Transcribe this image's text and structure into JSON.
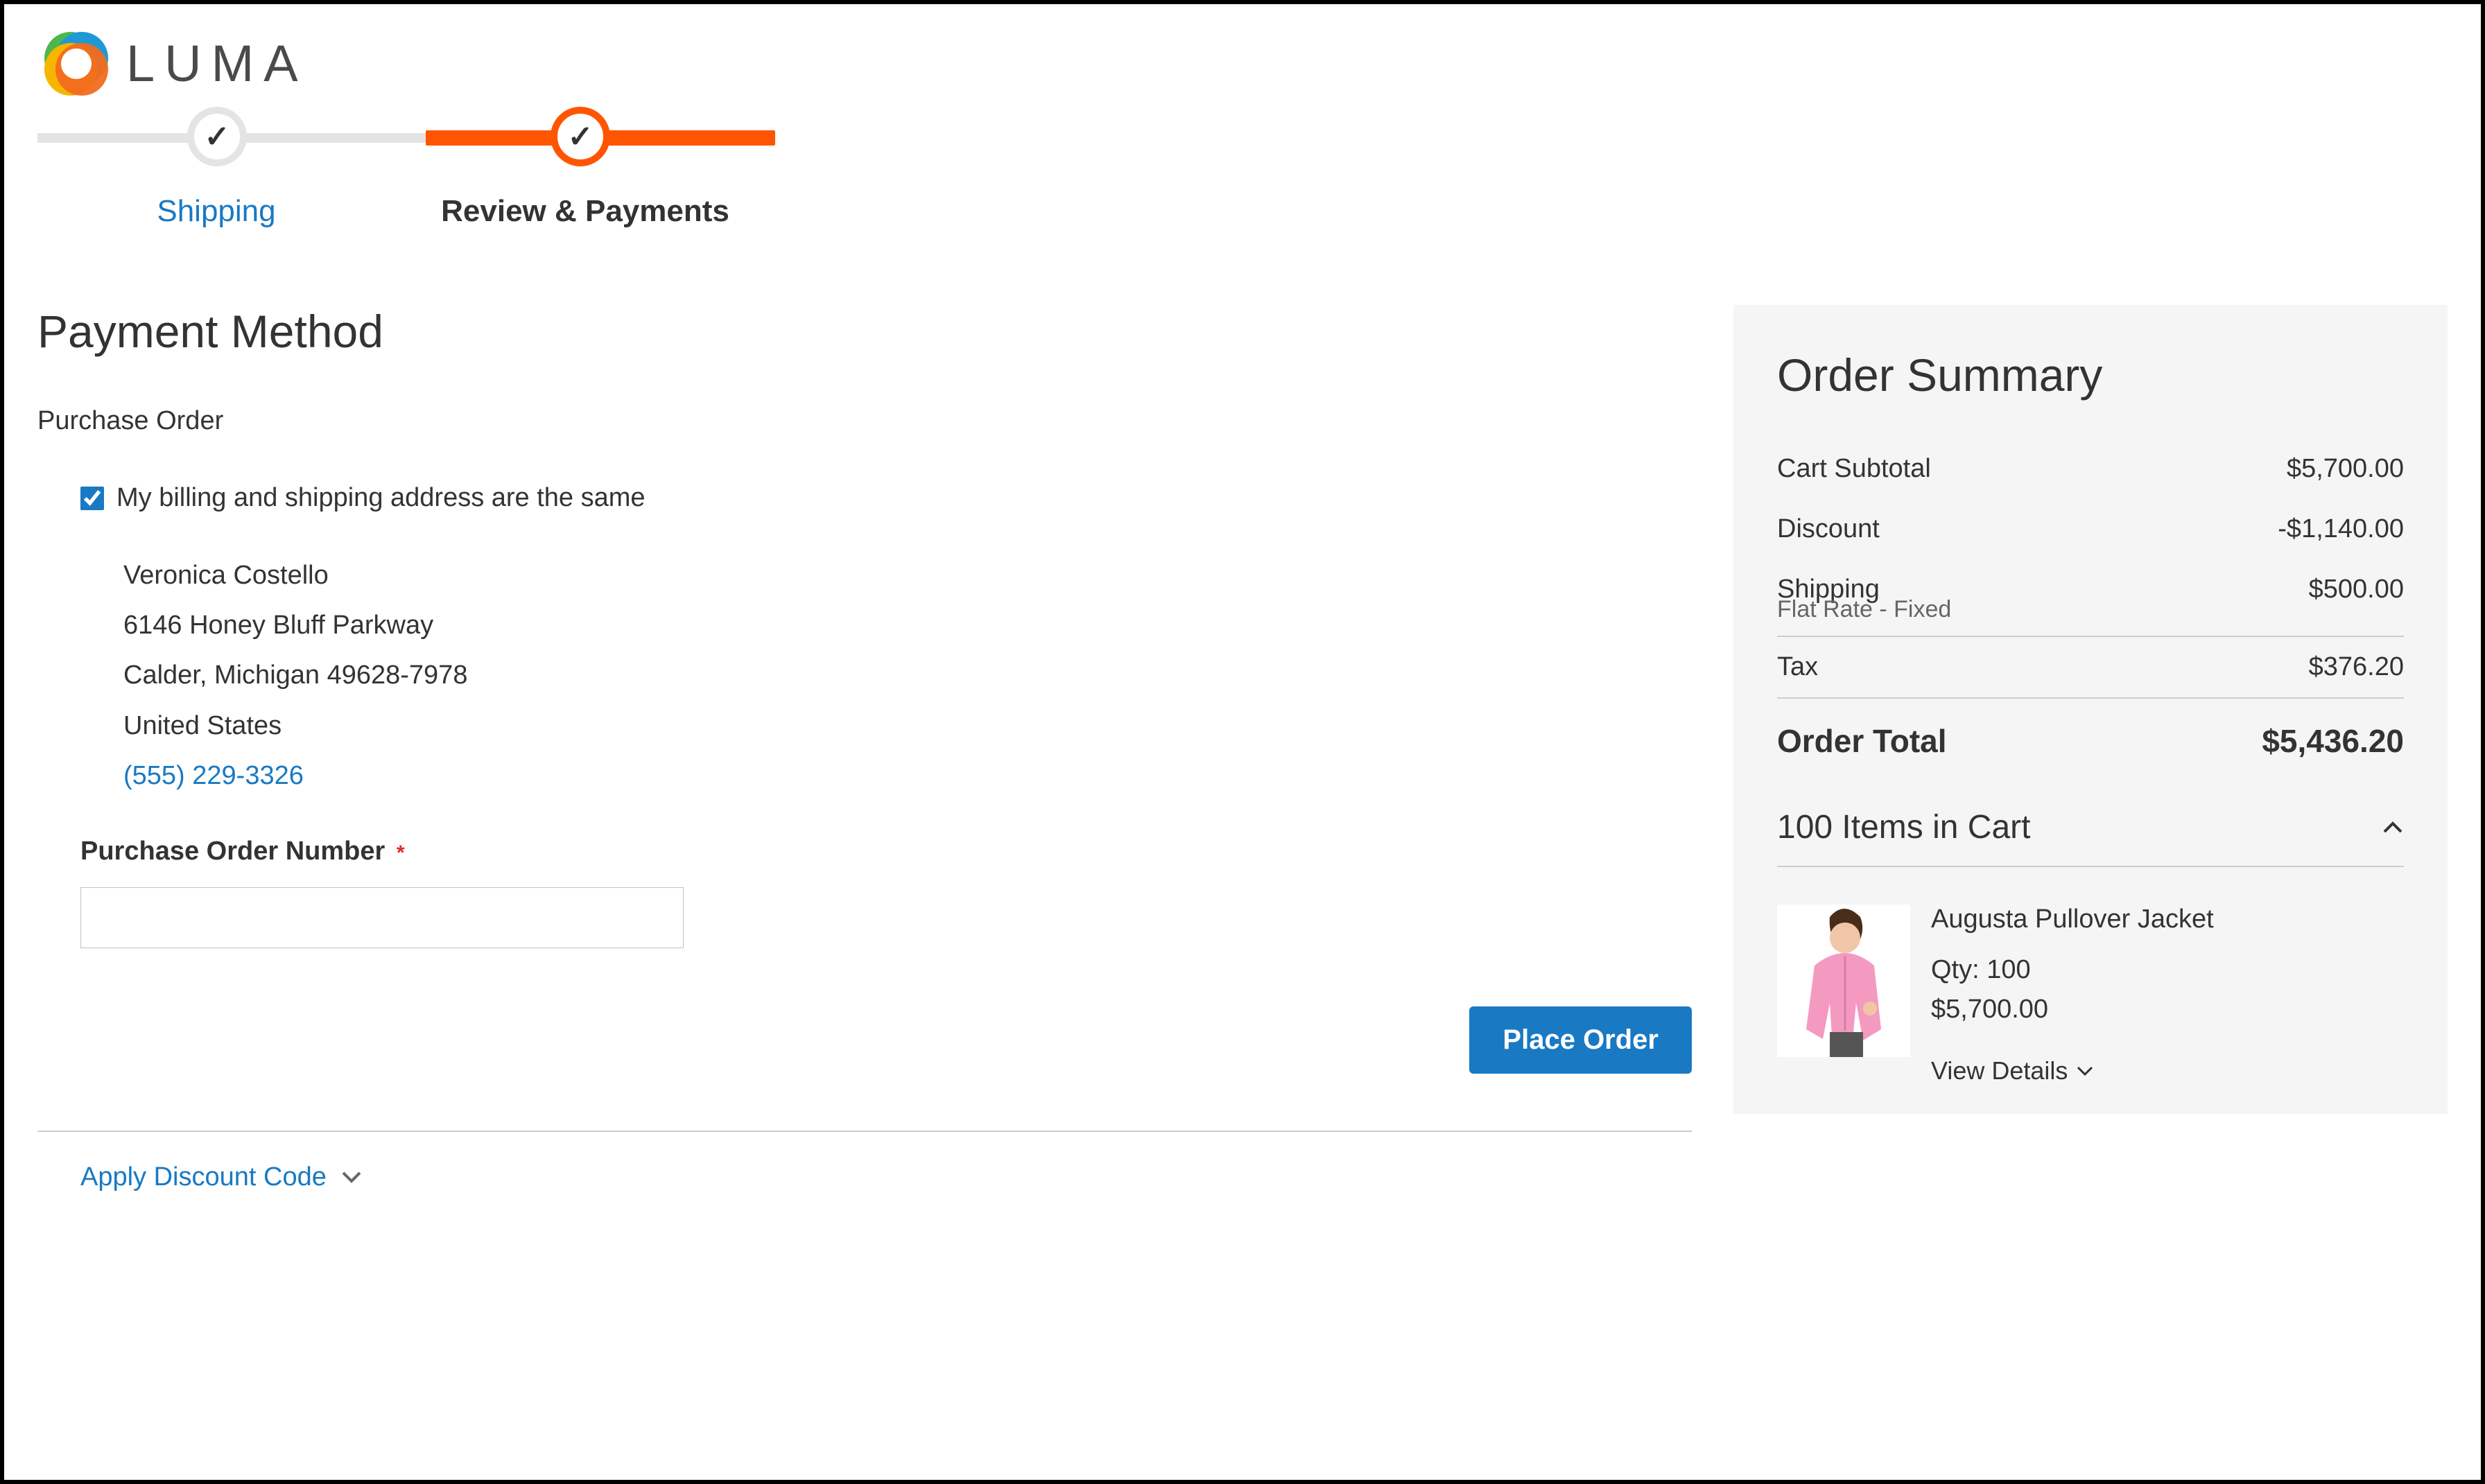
{
  "brand": {
    "name": "LUMA"
  },
  "progress": {
    "steps": {
      "shipping": {
        "label": "Shipping",
        "checked": true
      },
      "review": {
        "label": "Review & Payments",
        "checked": true,
        "active": true
      }
    }
  },
  "payment": {
    "title": "Payment Method",
    "method_label": "Purchase Order",
    "same_address_label": "My billing and shipping address are the same",
    "same_address_checked": true,
    "address": {
      "name": "Veronica Costello",
      "street": "6146 Honey Bluff Parkway",
      "city_line": "Calder, Michigan 49628-7978",
      "country": "United States",
      "phone": "(555) 229-3326"
    },
    "po_number_label": "Purchase Order Number",
    "po_number_value": "",
    "place_order_label": "Place Order",
    "discount_label": "Apply Discount Code"
  },
  "summary": {
    "title": "Order Summary",
    "lines": {
      "subtotal_label": "Cart Subtotal",
      "subtotal_value": "$5,700.00",
      "discount_label": "Discount",
      "discount_value": "-$1,140.00",
      "shipping_label": "Shipping",
      "shipping_value": "$500.00",
      "shipping_sub": "Flat Rate - Fixed",
      "tax_label": "Tax",
      "tax_value": "$376.20",
      "total_label": "Order Total",
      "total_value": "$5,436.20"
    },
    "cart": {
      "header": "100 Items in Cart",
      "item": {
        "name": "Augusta Pullover Jacket",
        "qty": "Qty: 100",
        "price": "$5,700.00",
        "view_details": "View Details"
      }
    }
  },
  "colors": {
    "accent": "#ff5501",
    "link": "#1979c3"
  }
}
